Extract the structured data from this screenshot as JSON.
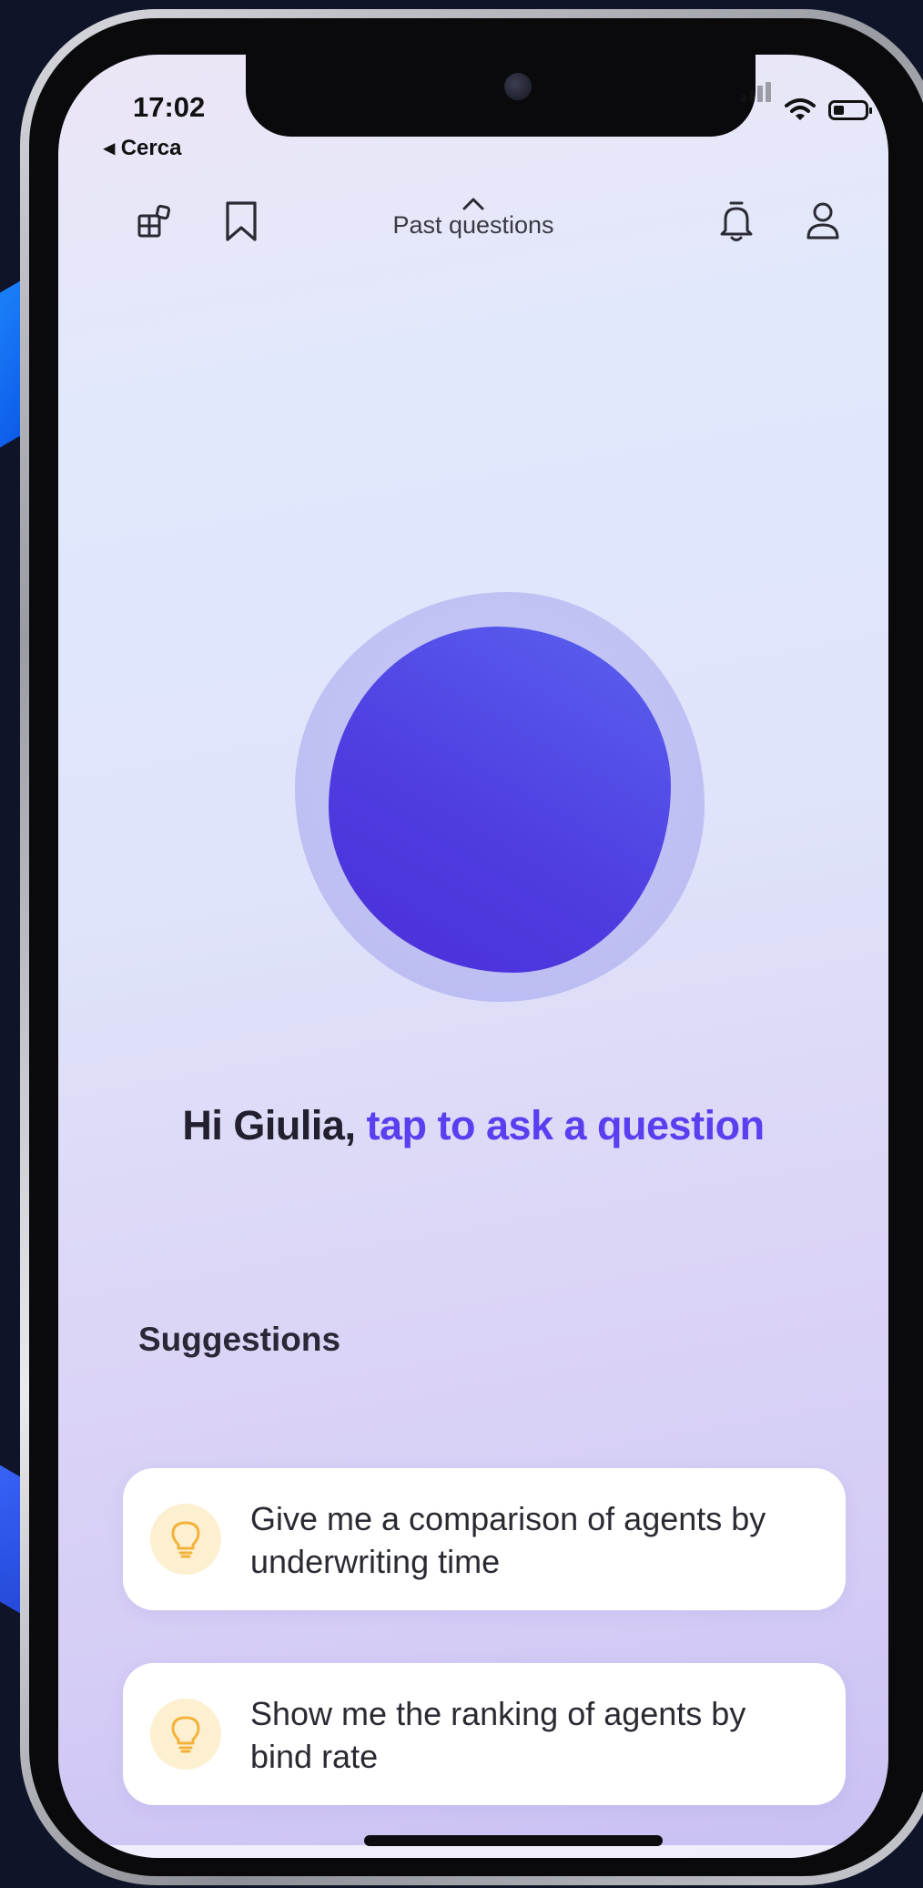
{
  "status_bar": {
    "time": "17:02",
    "back_label": "◂ Cerca"
  },
  "toolbar": {
    "left_icons": [
      "dashboard-icon",
      "bookmark-icon"
    ],
    "center_label": "Past questions",
    "right_icons": [
      "bell-icon",
      "profile-icon"
    ]
  },
  "greeting": {
    "name_part": "Hi Giulia, ",
    "cta_part": "tap to ask a question"
  },
  "suggestions": {
    "title": "Suggestions",
    "items": [
      {
        "text": "Give me a comparison of agents by underwriting time",
        "icon": "lightbulb-icon"
      },
      {
        "text": "Show me the ranking of agents by bind rate",
        "icon": "lightbulb-icon"
      }
    ]
  },
  "colors": {
    "accent": "#5a3ff0",
    "orb": "#4f3ee2",
    "bulb_bg": "#fdf0d1",
    "bulb_icon": "#f2b23a"
  }
}
